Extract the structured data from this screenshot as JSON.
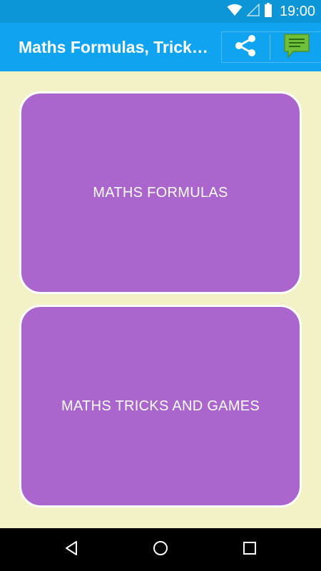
{
  "status_bar": {
    "time": "19:00",
    "icons": [
      "wifi-icon",
      "signal-icon",
      "battery-icon"
    ]
  },
  "app_bar": {
    "title": "Maths Formulas, Tricks and Games",
    "actions": [
      "share-icon",
      "chat-icon"
    ]
  },
  "cards": [
    {
      "label": "MATHS FORMULAS"
    },
    {
      "label": "MATHS TRICKS AND GAMES"
    }
  ],
  "navigation": {
    "buttons": [
      "back-icon",
      "home-icon",
      "recent-apps-icon"
    ]
  },
  "colors": {
    "status_bar": "#0d96d7",
    "app_bar": "#10a4f0",
    "background": "#f2f2c6",
    "card": "#aa66cc",
    "card_border": "#ffffff",
    "chat_icon": "#6fbf3a"
  }
}
